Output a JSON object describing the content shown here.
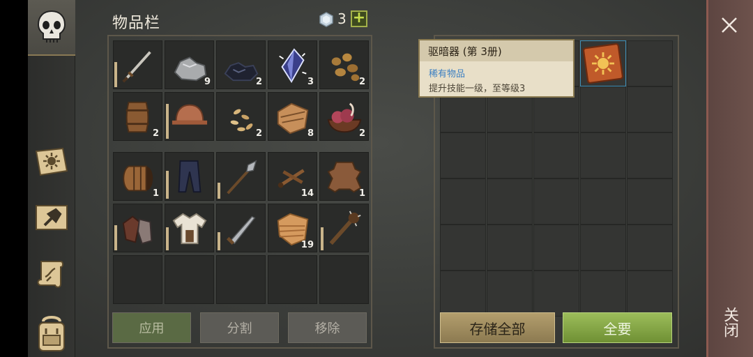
{
  "inventory": {
    "title": "物品栏",
    "gem_count": "3",
    "rows": [
      [
        {
          "icon": "sword-icon",
          "count": "",
          "dur": 0.55
        },
        {
          "icon": "stone-icon",
          "count": "9"
        },
        {
          "icon": "coal-icon",
          "count": "2"
        },
        {
          "icon": "crystal-icon",
          "count": "3"
        },
        {
          "icon": "nuts-icon",
          "count": "2"
        }
      ],
      [
        {
          "icon": "barrel-small-icon",
          "count": "2"
        },
        {
          "icon": "helmet-icon",
          "count": "",
          "dur": 0.75
        },
        {
          "icon": "seeds-icon",
          "count": "2"
        },
        {
          "icon": "leather-roll-icon",
          "count": "8"
        },
        {
          "icon": "meat-bowl-icon",
          "count": "2"
        }
      ],
      [
        {
          "icon": "barrel-icon",
          "count": "1"
        },
        {
          "icon": "pants-icon",
          "count": "",
          "dur": 0.6
        },
        {
          "icon": "halberd-icon",
          "count": "",
          "dur": 0.35
        },
        {
          "icon": "sticks-icon",
          "count": "14"
        },
        {
          "icon": "hide-icon",
          "count": "1"
        }
      ],
      [
        {
          "icon": "gloves-icon",
          "count": "",
          "dur": 0.55
        },
        {
          "icon": "shirt-icon",
          "count": "",
          "dur": 0.5
        },
        {
          "icon": "blade-icon",
          "count": "",
          "dur": 0.4
        },
        {
          "icon": "cloth-icon",
          "count": "19"
        },
        {
          "icon": "club-icon",
          "count": "",
          "dur": 0.5
        }
      ],
      [
        {
          "icon": "",
          "count": ""
        },
        {
          "icon": "",
          "count": ""
        },
        {
          "icon": "",
          "count": ""
        },
        {
          "icon": "",
          "count": ""
        },
        {
          "icon": "",
          "count": ""
        }
      ]
    ],
    "buttons": {
      "apply": "应用",
      "split": "分割",
      "remove": "移除"
    }
  },
  "storage": {
    "buttons": {
      "store_all": "存储全部",
      "take_all": "全要"
    },
    "item": {
      "icon": "sun-book-icon"
    }
  },
  "tooltip": {
    "title": "驱暗器 (第 3册)",
    "rarity": "稀有物品",
    "description": "提升技能一级，至等级3"
  },
  "close": {
    "label": "关闭"
  }
}
